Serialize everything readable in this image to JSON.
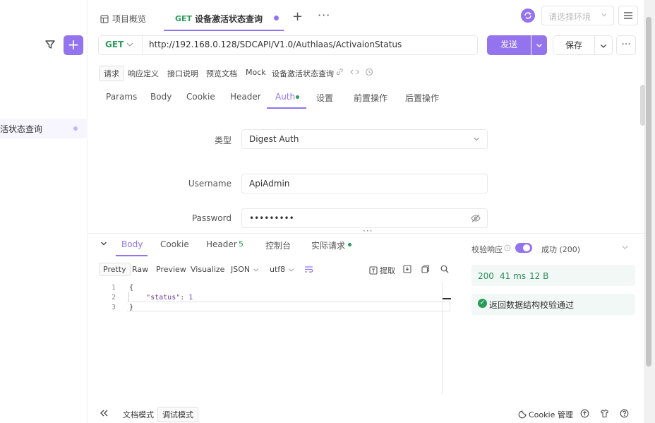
{
  "sidebar": {
    "item_label": "活状态查询"
  },
  "tabs": {
    "home_label": "项目概览",
    "active_method": "GET",
    "active_label": "设备激活状态查询"
  },
  "env": {
    "placeholder": "请选择环境"
  },
  "request": {
    "method": "GET",
    "url": "http://192.168.0.128/SDCAPI/V1.0/Authlaas/ActivaionStatus",
    "send_label": "发送",
    "save_label": "保存"
  },
  "subtabs": [
    "请求",
    "响应定义",
    "接口说明",
    "预览文档",
    "Mock",
    "设备激活状态查询"
  ],
  "param_tabs": [
    "Params",
    "Body",
    "Cookie",
    "Header",
    "Auth",
    "设置",
    "前置操作",
    "后置操作"
  ],
  "auth": {
    "type_label": "类型",
    "type_value": "Digest Auth",
    "username_label": "Username",
    "username_value": "ApiAdmin",
    "password_label": "Password",
    "password_value": "•••••••••"
  },
  "response": {
    "tabs": [
      "Body",
      "Cookie",
      "Header",
      "控制台",
      "实际请求"
    ],
    "header_count": "5",
    "format_tools": [
      "Pretty",
      "Raw",
      "Preview",
      "Visualize",
      "JSON",
      "utf8"
    ],
    "extract_label": "提取",
    "code_lines": [
      {
        "n": "1",
        "text": "{"
      },
      {
        "n": "2",
        "text": "    \"status\": 1"
      },
      {
        "n": "3",
        "text": "}"
      }
    ]
  },
  "verify": {
    "label": "校验响应",
    "status": "成功 (200)",
    "code": "200",
    "time": "41 ms",
    "size": "12 B",
    "result": "返回数据结构校验通过"
  },
  "bottom": {
    "doc_mode": "文档模式",
    "debug_mode": "调试模式",
    "cookie_label": "Cookie 管理"
  },
  "colors": {
    "accent": "#9373ee",
    "method_get": "#2a9c58",
    "success": "#2a8c5c"
  }
}
